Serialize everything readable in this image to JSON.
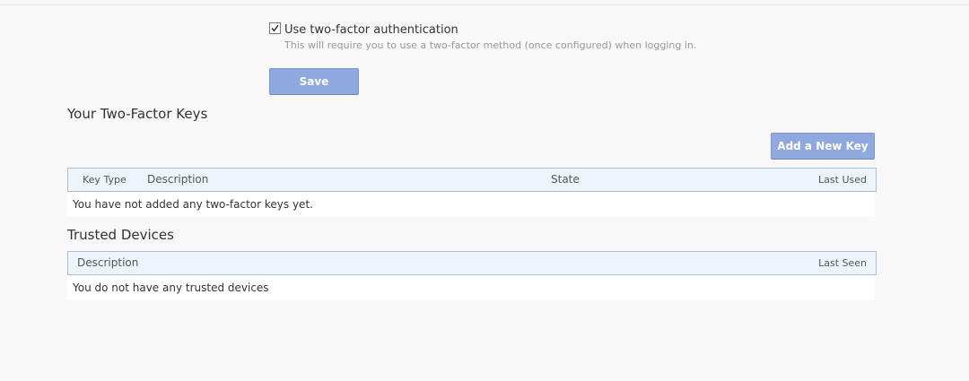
{
  "tfa": {
    "checkbox_checked": true,
    "label": "Use two-factor authentication",
    "hint": "This will require you to use a two-factor method (once configured) when logging in."
  },
  "save_button": "Save",
  "keys_section": {
    "title": "Your Two-Factor Keys",
    "add_button": "Add a New Key",
    "columns": [
      "Key Type",
      "Description",
      "State",
      "Last Used"
    ],
    "empty_message": "You have not added any two-factor keys yet."
  },
  "trusted_section": {
    "title": "Trusted Devices",
    "columns": [
      "Description",
      "Last Seen"
    ],
    "empty_message": "You do not have any trusted devices"
  },
  "colors": {
    "page_background": "#f8f8f8",
    "button_background": "#8fa8dd",
    "table_header_background": "#eef4fb",
    "table_header_border": "#a9bfd6"
  }
}
